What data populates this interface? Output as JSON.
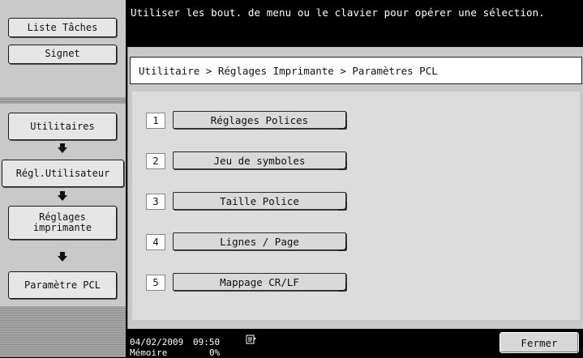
{
  "sidebar": {
    "task_list_label": "Liste Tâches",
    "bookmark_label": "Signet",
    "nav": [
      {
        "label": "Utilitaires"
      },
      {
        "label": "Régl.Utilisateur"
      },
      {
        "label": "Réglages\nimprimante"
      },
      {
        "label": "Paramètre PCL"
      }
    ]
  },
  "message": "Utiliser les bout. de menu ou le clavier pour opérer une sélection.",
  "breadcrumb": "Utilitaire > Réglages Imprimante > Paramètres PCL",
  "options": [
    {
      "num": "1",
      "label": "Réglages Polices"
    },
    {
      "num": "2",
      "label": "Jeu de symboles"
    },
    {
      "num": "3",
      "label": "Taille Police"
    },
    {
      "num": "4",
      "label": "Lignes / Page"
    },
    {
      "num": "5",
      "label": "Mappage CR/LF"
    }
  ],
  "status": {
    "date": "04/02/2009",
    "time": "09:50",
    "memory_label": "Mémoire",
    "memory_value": "0%",
    "icon": "document-icon"
  },
  "close_label": "Fermer",
  "colors": {
    "background": "#000000",
    "panel": "#c8c8c8",
    "button": "#d9d9d9"
  }
}
